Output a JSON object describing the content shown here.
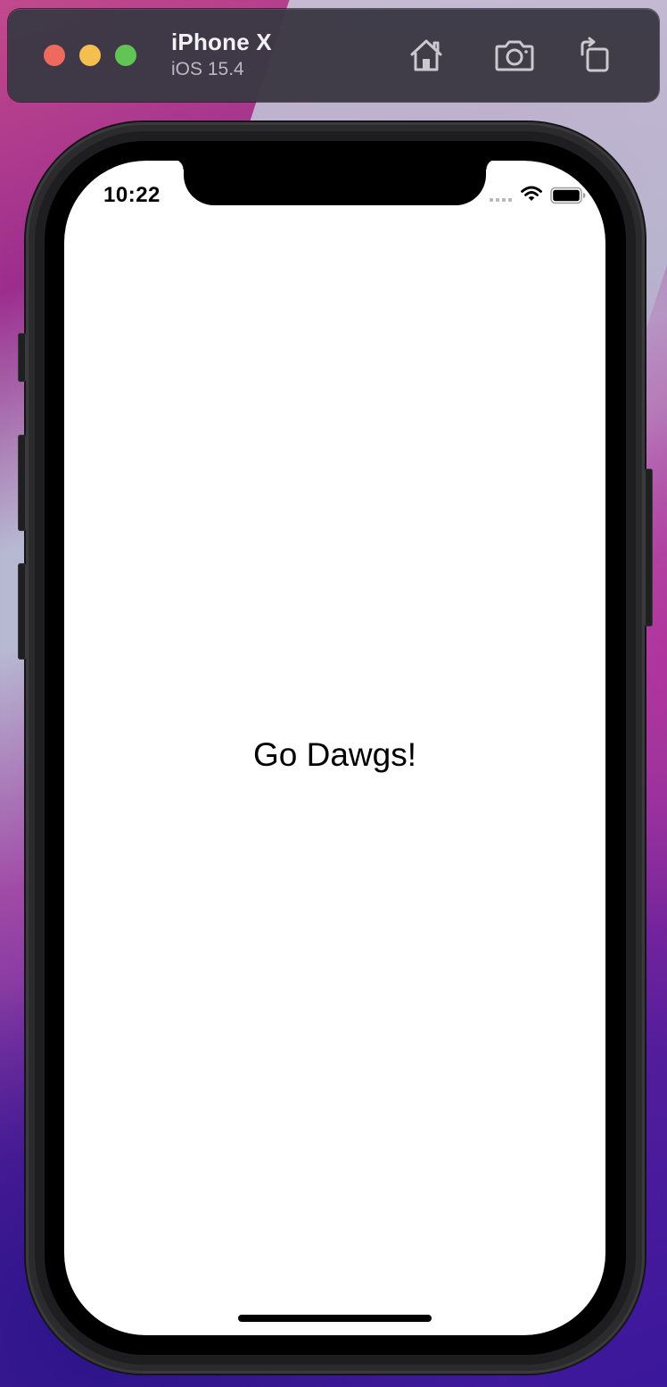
{
  "simulator": {
    "device_name": "iPhone X",
    "os_version": "iOS 15.4",
    "icons": {
      "close": "close-window-dot",
      "minimize": "minimize-window-dot",
      "zoom": "zoom-window-dot",
      "home": "home-icon",
      "screenshot": "camera-icon",
      "rotate": "rotate-icon"
    },
    "colors": {
      "close": "#ee6a5f",
      "minimize": "#f5bf4f",
      "zoom": "#61c454"
    }
  },
  "status_bar": {
    "time": "10:22",
    "icons": [
      "cellular-signal-icon",
      "wifi-icon",
      "battery-icon"
    ]
  },
  "app": {
    "label": "Go Dawgs!"
  }
}
